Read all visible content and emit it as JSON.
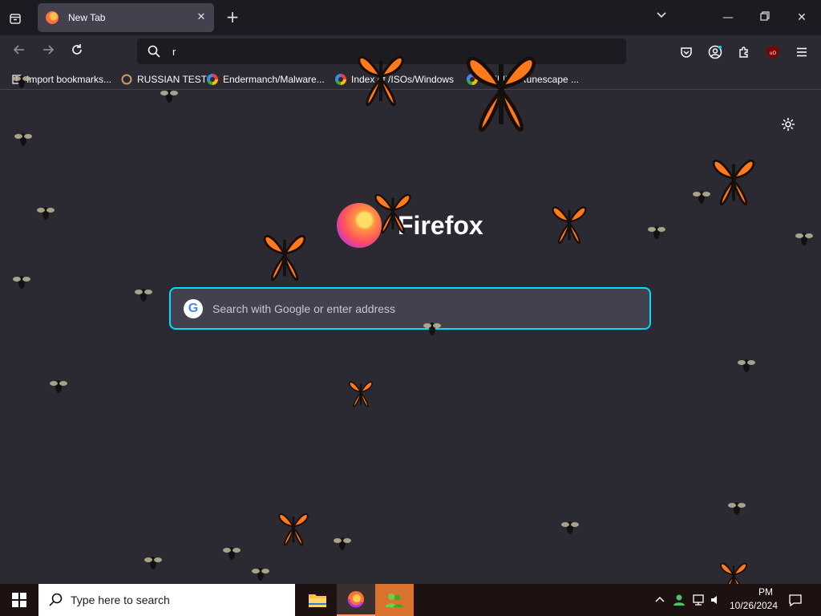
{
  "tab": {
    "title": "New Tab"
  },
  "urlbar": {
    "value": "r"
  },
  "bookmarks": [
    {
      "label": "Import bookmarks..."
    },
    {
      "label": "RUSSIAN TEST"
    },
    {
      "label": "Endermanch/Malware..."
    },
    {
      "label": "Index of /ISOs/Windows"
    },
    {
      "label": "MEMZ - Runescape ..."
    }
  ],
  "brand": {
    "wordmark": "Firefox"
  },
  "search": {
    "placeholder": "Search with Google or enter address"
  },
  "taskbar": {
    "search_placeholder": "Type here to search",
    "clock_time": "PM",
    "clock_date": "10/26/2024"
  },
  "colors": {
    "accent": "#00ddff",
    "tab_bg": "#42414d",
    "content_bg": "#2b2a33",
    "butterfly": "#ff7a1a"
  }
}
